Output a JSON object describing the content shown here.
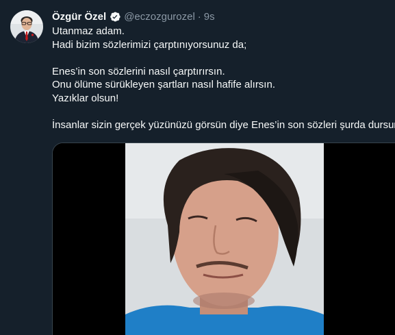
{
  "tweet": {
    "author": {
      "display_name": "Özgür Özel",
      "handle": "@eczozgurozel",
      "verified": true
    },
    "separator": "·",
    "time": "9s",
    "lines": [
      "Utanmaz adam.",
      "Hadi bizim sözlerimizi çarptınıyorsunuz da;",
      "",
      "Enes’in son sözlerini nasıl çarptırırsın.",
      "Onu ölüme sürükleyen şartları nasıl hafife alırsın.",
      "Yazıklar olsun!",
      "",
      "İnsanlar sizin gerçek yüzünüzü görsün diye Enes’in son sözleri şurda dursun:"
    ],
    "media": {
      "type": "video",
      "icon": "video-thumbnail"
    }
  },
  "colors": {
    "background": "#15202b",
    "text": "#f7f9f9",
    "secondary_text": "#8b98a5",
    "verified": "#1d9bf0",
    "border": "#38444d"
  }
}
